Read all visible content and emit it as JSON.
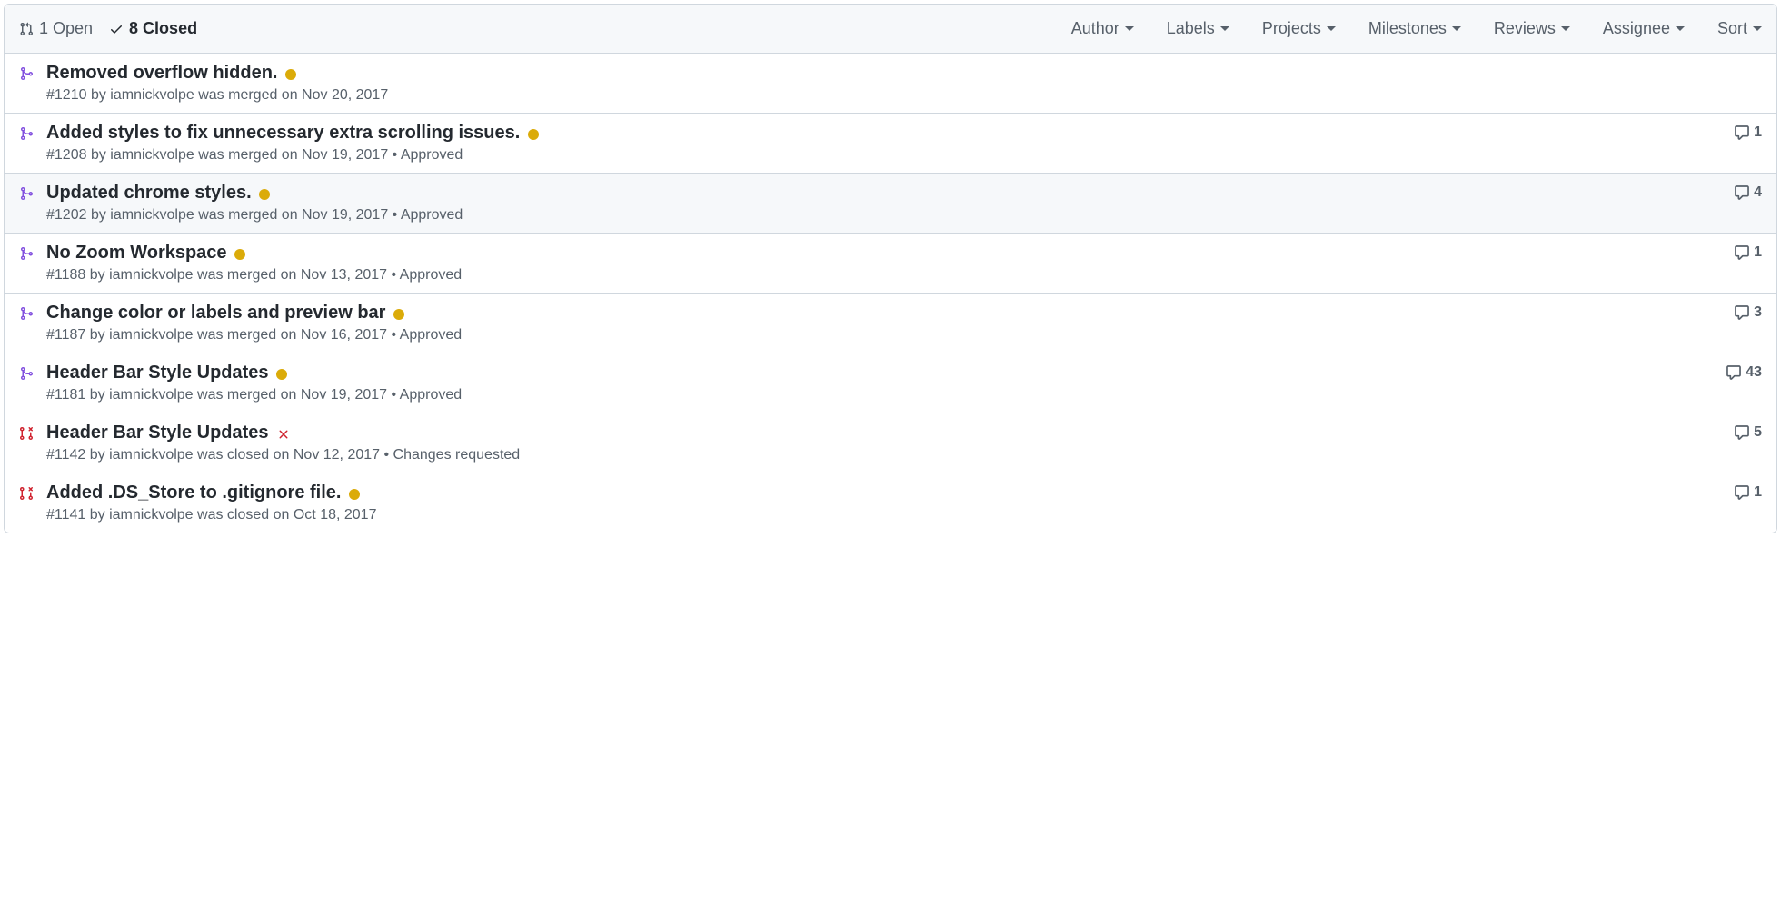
{
  "header": {
    "open_count": "1 Open",
    "closed_count": "8 Closed",
    "filters": [
      "Author",
      "Labels",
      "Projects",
      "Milestones",
      "Reviews",
      "Assignee",
      "Sort"
    ]
  },
  "rows": [
    {
      "icon": "merged",
      "title": "Removed overflow hidden.",
      "status": "dot-yellow",
      "subtitle": "#1210 by iamnickvolpe was merged on Nov 20, 2017",
      "comments": null,
      "hover": false
    },
    {
      "icon": "merged",
      "title": "Added styles to fix unnecessary extra scrolling issues.",
      "status": "dot-yellow",
      "subtitle": "#1208 by iamnickvolpe was merged on Nov 19, 2017 • Approved",
      "comments": "1",
      "hover": false
    },
    {
      "icon": "merged",
      "title": "Updated chrome styles.",
      "status": "dot-yellow",
      "subtitle": "#1202 by iamnickvolpe was merged on Nov 19, 2017 • Approved",
      "comments": "4",
      "hover": true
    },
    {
      "icon": "merged",
      "title": "No Zoom Workspace",
      "status": "dot-yellow",
      "subtitle": "#1188 by iamnickvolpe was merged on Nov 13, 2017 • Approved",
      "comments": "1",
      "hover": false
    },
    {
      "icon": "merged",
      "title": "Change color or labels and preview bar",
      "status": "dot-yellow",
      "subtitle": "#1187 by iamnickvolpe was merged on Nov 16, 2017 • Approved",
      "comments": "3",
      "hover": false
    },
    {
      "icon": "merged",
      "title": "Header Bar Style Updates",
      "status": "dot-yellow",
      "subtitle": "#1181 by iamnickvolpe was merged on Nov 19, 2017 • Approved",
      "comments": "43",
      "hover": false
    },
    {
      "icon": "closed",
      "title": "Header Bar Style Updates",
      "status": "x-red",
      "subtitle": "#1142 by iamnickvolpe was closed on Nov 12, 2017 • Changes requested",
      "comments": "5",
      "hover": false
    },
    {
      "icon": "closed",
      "title": "Added .DS_Store to .gitignore file.",
      "status": "dot-yellow",
      "subtitle": "#1141 by iamnickvolpe was closed on Oct 18, 2017",
      "comments": "1",
      "hover": false
    }
  ]
}
